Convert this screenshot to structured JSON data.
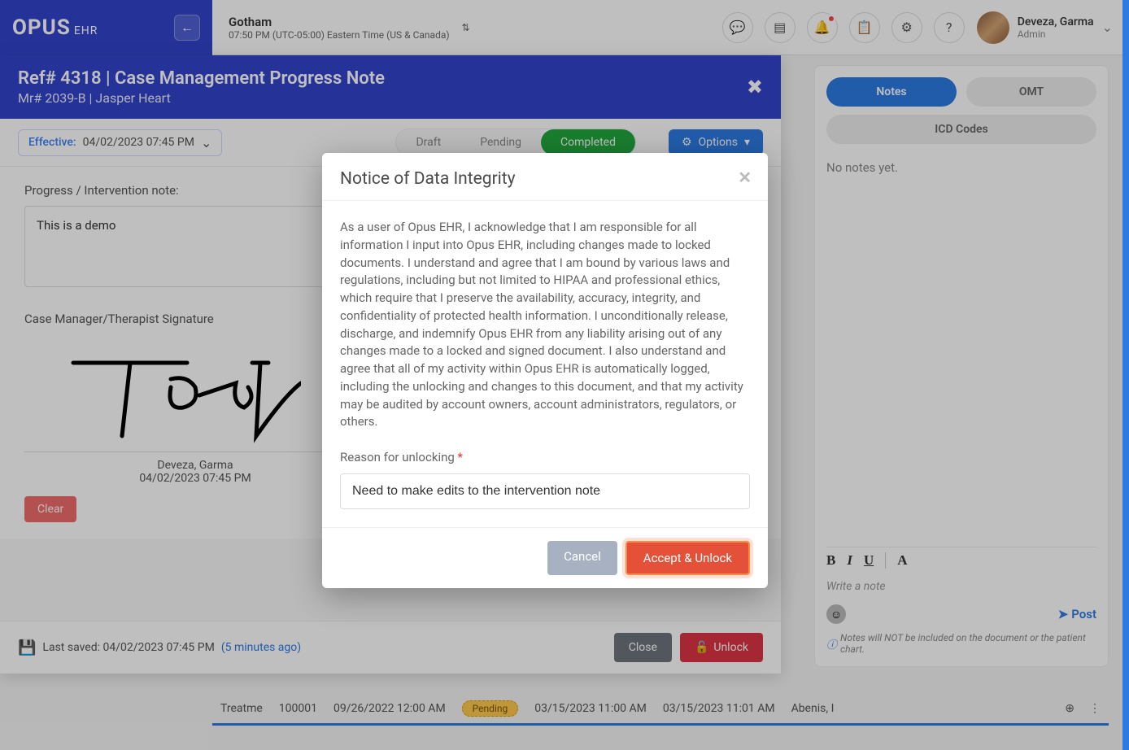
{
  "header": {
    "logo_main": "OPUS",
    "logo_sub": "EHR",
    "org_name": "Gotham",
    "org_tz": "07:50 PM (UTC-05:00) Eastern Time (US & Canada)",
    "user_name": "Deveza, Garma",
    "user_role": "Admin"
  },
  "doc": {
    "title": "Ref# 4318 | Case Management Progress Note",
    "subtitle": "Mr# 2039-B | Jasper Heart",
    "effective_label": "Effective:",
    "effective_date": "04/02/2023 07:45 PM",
    "status_draft": "Draft",
    "status_pending": "Pending",
    "status_completed": "Completed",
    "options": "Options",
    "progress_label": "Progress / Intervention note:",
    "progress_text": "This is a demo",
    "sig_label": "Case Manager/Therapist Signature",
    "sig_name": "Deveza, Garma",
    "sig_date": "04/02/2023 07:45 PM",
    "clear": "Clear",
    "last_saved_prefix": "Last saved: 04/02/2023 07:45 PM ",
    "last_saved_ago": "(5 minutes ago)",
    "close": "Close",
    "unlock": "Unlock"
  },
  "right": {
    "tab_notes": "Notes",
    "tab_omt": "OMT",
    "tab_icd": "ICD Codes",
    "no_notes": "No notes yet.",
    "bold": "B",
    "italic": "I",
    "underline": "U",
    "font": "A",
    "write_placeholder": "Write a note",
    "post": "Post",
    "disclaimer": "Notes will NOT be included on the document or the patient chart."
  },
  "bottom": {
    "col1": "Treatme",
    "col2": "100001",
    "col3": "09/26/2022 12:00 AM",
    "pending": "Pending",
    "col5": "03/15/2023 11:00 AM",
    "col6": "03/15/2023 11:01 AM",
    "col7": "Abenis, I"
  },
  "modal": {
    "title": "Notice of Data Integrity",
    "body": "As a user of Opus EHR, I acknowledge that I am responsible for all information I input into Opus EHR, including changes made to locked documents. I understand and agree that I am bound by various laws and regulations, including but not limited to HIPAA and professional ethics, which require that I preserve the availability, accuracy, integrity, and confidentiality of protected health information. I unconditionally release, discharge, and indemnify Opus EHR from any liability arising out of any changes made to a locked and signed document. I also understand and agree that all of my activity within Opus EHR is automatically logged, including the unlocking and changes to this document, and that my activity may be audited by account owners, account administrators, regulators, or others.",
    "reason_label": "Reason for unlocking ",
    "reason_value": "Need to make edits to the intervention note",
    "cancel": "Cancel",
    "accept": "Accept & Unlock"
  }
}
